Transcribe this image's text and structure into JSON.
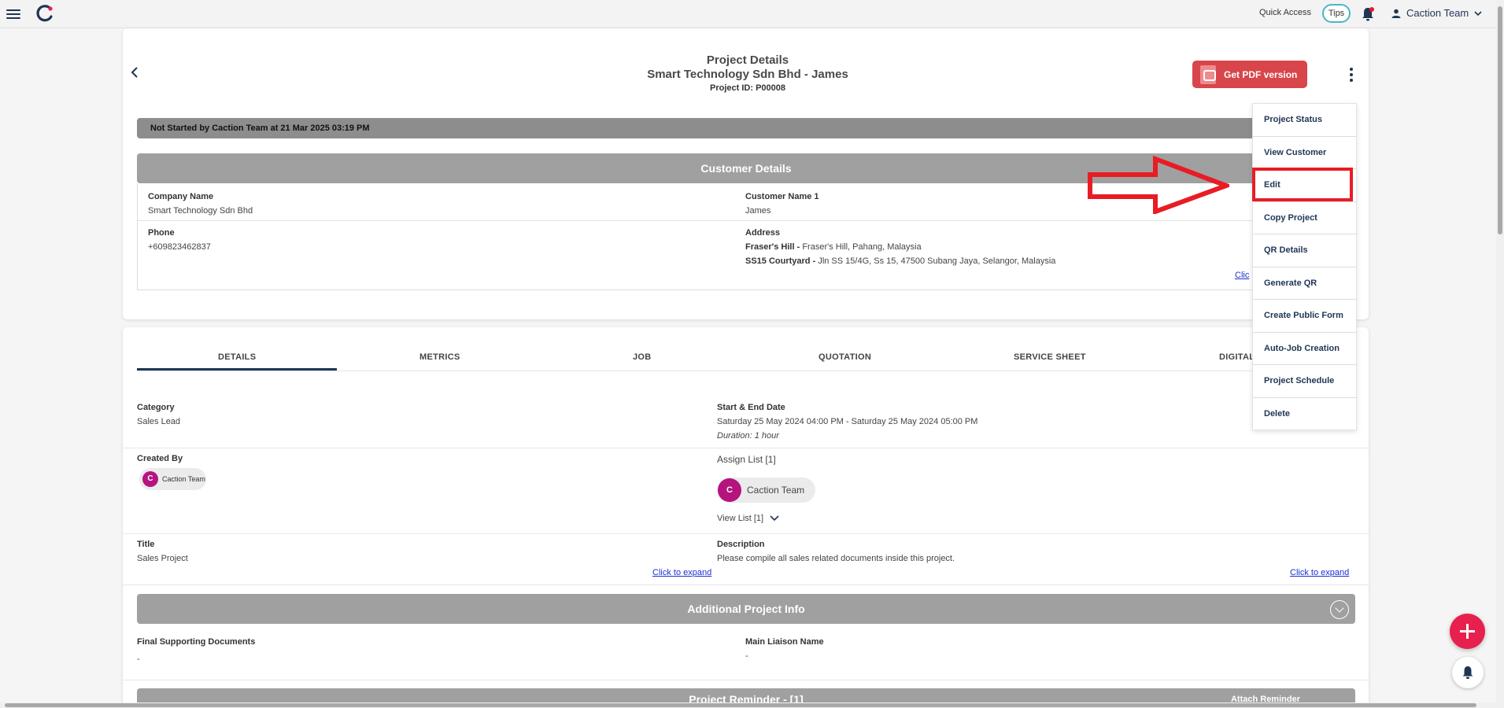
{
  "topbar": {
    "quick_access": "Quick Access",
    "tips": "Tips",
    "user_name": "Caction Team"
  },
  "header": {
    "title": "Project Details",
    "subtitle": "Smart Technology Sdn Bhd - James",
    "project_id": "Project ID: P00008",
    "pdf_button": "Get PDF version"
  },
  "status_text": "Not Started by Caction Team at 21 Mar 2025 03:19 PM",
  "customer": {
    "header": "Customer Details",
    "company_label": "Company Name",
    "company_value": "Smart Technology Sdn Bhd",
    "customer_label": "Customer Name 1",
    "customer_value": "James",
    "phone_label": "Phone",
    "phone_value": "+609823462837",
    "address_label": "Address",
    "address1_name": "Fraser's Hill -",
    "address1_value": "Fraser's Hill, Pahang, Malaysia",
    "address2_name": "SS15 Courtyard -",
    "address2_value": "Jln SS 15/4G, Ss 15, 47500 Subang Jaya, Selangor, Malaysia",
    "link_partial": "Clic"
  },
  "tabs": [
    {
      "label": "DETAILS"
    },
    {
      "label": "METRICS"
    },
    {
      "label": "JOB"
    },
    {
      "label": "QUOTATION"
    },
    {
      "label": "SERVICE SHEET"
    },
    {
      "label": "DIGITAL"
    }
  ],
  "details": {
    "category_label": "Category",
    "category_value": "Sales Lead",
    "date_label": "Start & End Date",
    "date_value": "Saturday 25 May 2024 04:00 PM - Saturday 25 May 2024 05:00 PM",
    "duration": "Duration: 1 hour",
    "created_label": "Created By",
    "created_initial": "C",
    "created_name": "Caction Team",
    "assign_label": "Assign List [1]",
    "assign_initial": "C",
    "assign_name": "Caction Team",
    "view_list": "View List [1]",
    "title_label": "Title",
    "title_value": "Sales Project",
    "desc_label": "Description",
    "desc_value": "Please compile all sales related documents inside this project.",
    "expand1": "Click to expand",
    "expand2": "Click to expand"
  },
  "additional": {
    "header": "Additional Project Info",
    "docs_label": "Final Supporting Documents",
    "docs_value": "-",
    "liaison_label": "Main Liaison Name",
    "liaison_value": "-"
  },
  "reminder": {
    "header": "Project Reminder - [1]",
    "attach": "Attach Reminder"
  },
  "menu": [
    "Project Status",
    "View Customer",
    "Edit",
    "Copy Project",
    "QR Details",
    "Generate QR",
    "Create Public Form",
    "Auto-Job Creation",
    "Project Schedule",
    "Delete"
  ],
  "colors": {
    "accent_navy": "#1f3554",
    "pdf_red": "#d8454a",
    "highlight_red": "#e81c24",
    "avatar_magenta": "#b5137e",
    "fab_pink": "#e8204e"
  }
}
